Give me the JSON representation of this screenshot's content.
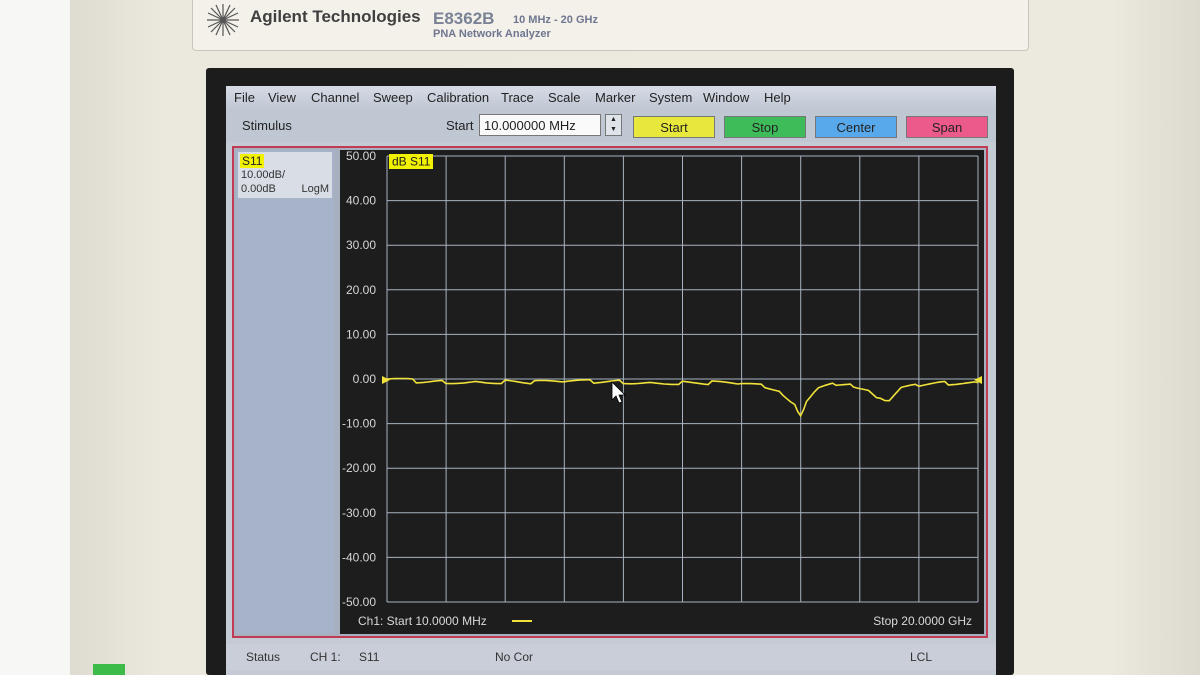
{
  "header": {
    "brand": "Agilent Technologies",
    "model": "E8362B",
    "range": "10 MHz - 20 GHz",
    "subtitle": "PNA Network Analyzer"
  },
  "menu": [
    "File",
    "View",
    "Channel",
    "Sweep",
    "Calibration",
    "Trace",
    "Scale",
    "Marker",
    "System",
    "Window",
    "Help"
  ],
  "toolbar": {
    "stimulus_label": "Stimulus",
    "start_label": "Start",
    "start_value": "10.000000 MHz",
    "buttons": [
      {
        "label": "Start",
        "color": "#e8e83c"
      },
      {
        "label": "Stop",
        "color": "#3fbc5a"
      },
      {
        "label": "Center",
        "color": "#58a9ec"
      },
      {
        "label": "Span",
        "color": "#ec5a8c"
      }
    ]
  },
  "trace_info": {
    "name": "S11",
    "scale": "10.00dB/",
    "reference": "0.00dB",
    "format": "LogM"
  },
  "chart_data": {
    "type": "line",
    "trace_label": "dB S11",
    "y_ticks": [
      "50.00",
      "40.00",
      "30.00",
      "20.00",
      "10.00",
      "0.00",
      "-10.00",
      "-20.00",
      "-30.00",
      "-40.00",
      "-50.00"
    ],
    "ylim": [
      -50,
      50
    ],
    "xlim_ghz": [
      0.01,
      20
    ],
    "x_divisions": 10,
    "grid": true,
    "trace_color": "#f0e23a",
    "series": [
      {
        "x": [
          0.01,
          1,
          2,
          3,
          4,
          5,
          6,
          7,
          8,
          9,
          10,
          11,
          12,
          12.8,
          13.4,
          13.8,
          14.0,
          14.2,
          14.6,
          15.2,
          15.8,
          16.3,
          16.7,
          17.0,
          17.4,
          18,
          19,
          20
        ],
        "values": [
          0,
          -0.5,
          -0.6,
          -0.5,
          -0.6,
          -0.8,
          -0.7,
          -0.6,
          -0.6,
          -0.7,
          -0.8,
          -0.9,
          -1.2,
          -1.7,
          -3.2,
          -5.5,
          -8.5,
          -5.5,
          -2.2,
          -1.2,
          -1.4,
          -2.3,
          -4.5,
          -5.3,
          -2.2,
          -1.5,
          -0.9,
          -0.8
        ]
      }
    ],
    "footer_left": "Ch1: Start  10.0000 MHz",
    "footer_right": "Stop  20.0000 GHz"
  },
  "status": {
    "label": "Status",
    "channel": "CH 1:",
    "param": "S11",
    "correction": "No Cor",
    "remote": "LCL"
  }
}
